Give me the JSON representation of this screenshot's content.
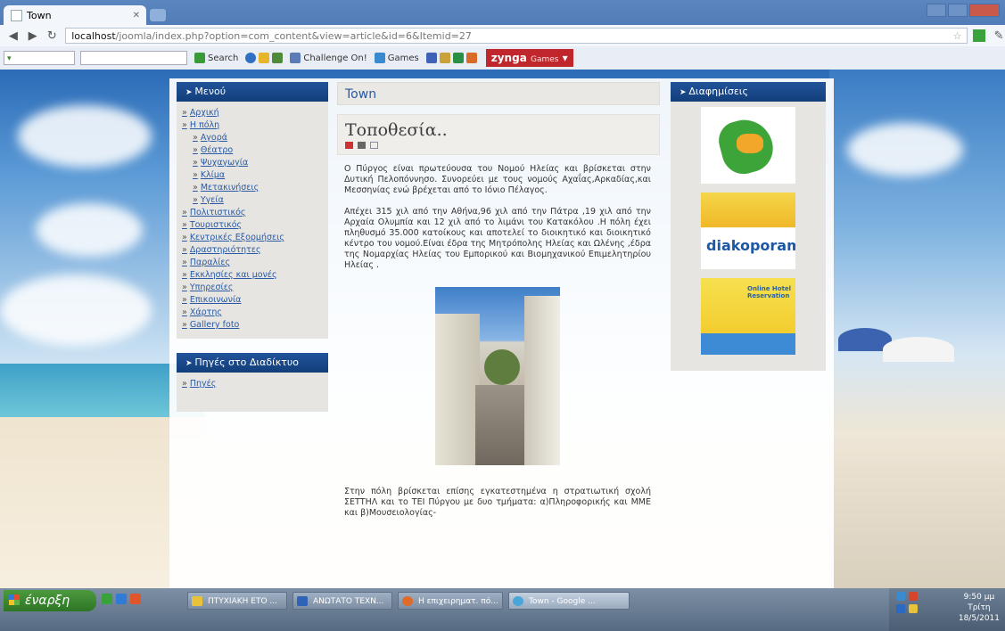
{
  "browser": {
    "tab_title": "Town",
    "url_host": "localhost",
    "url_path": "/joomla/index.php?option=com_content&view=article&id=6&Itemid=27"
  },
  "toolbar": {
    "search_label": "Search",
    "challenge_label": "Challenge On!",
    "games_label": "Games",
    "zynga_label": "zynga",
    "zynga_sub": "Games"
  },
  "left": {
    "menu_heading": "Μενού",
    "menu_items": [
      {
        "label": "Αρχική"
      },
      {
        "label": "Η πόλη"
      },
      {
        "label": "Αγορά"
      },
      {
        "label": "Θέατρο"
      },
      {
        "label": "Ψυχαγωγία"
      },
      {
        "label": "Κλίμα"
      },
      {
        "label": "Μετακινήσεις"
      },
      {
        "label": "Υγεία"
      },
      {
        "label": "Πολιτιστικός"
      },
      {
        "label": "Τουριστικός"
      },
      {
        "label": "Κεντρικές Εξορμήσεις"
      },
      {
        "label": "Δραστηριότητες"
      },
      {
        "label": "Παραλίες"
      },
      {
        "label": "Εκκλησίες και μονές"
      },
      {
        "label": "Υπηρεσίες"
      },
      {
        "label": "Επικοινωνία"
      },
      {
        "label": "Χάρτης"
      },
      {
        "label": "Gallery foto"
      }
    ],
    "links_heading": "Πηγές στο Διαδίκτυο",
    "links_items": [
      {
        "label": "Πηγές"
      }
    ]
  },
  "center": {
    "page_title": "Town",
    "article_title": "Τοποθεσία..",
    "para1": "Ο Πύργος είναι πρωτεύουσα του Νομού Ηλείας και βρίσκεται στην Δυτική Πελοπόννησο. Συνορεύει με τους νομούς Αχαΐας,Αρκαδίας,και Μεσσηνίας ενώ βρέχεται από το Ιόνιο Πέλαγος.",
    "para2": "Απέχει 315 χιλ από την Αθήνα,96 χιλ από την Πάτρα ,19 χιλ από την Αρχαία Ολυμπία και 12 χιλ από το λιμάνι του Κατακόλου .Η πόλη έχει πληθυσμό 35.000 κατοίκους και αποτελεί το διοικητικό και διοικητικό κέντρο του νομού.Είναι έδρα της Μητρόπολης Ηλείας και Ωλένης ,έδρα της Νομαρχίας Ηλείας του Εμπορικού και Βιομηχανικού Επιμελητηρίου Ηλείας .",
    "para3": "Στην πόλη βρίσκεται επίσης εγκατεστημένα η στρατιωτική σχολή ΣΕΤΤΗΛ και το ΤΕΙ Πύργου με δυο τμήματα: α)Πληροφορικής και ΜΜΕ και β)Μουσειολογίας-"
  },
  "right": {
    "ads_heading": "Διαφημίσεις",
    "ad2_text": "diakoporama",
    "ad3_text": "Online Hotel Reservation"
  },
  "taskbar": {
    "start_label": "έναρξη",
    "buttons": [
      {
        "label": "ΠΤΥΧΙΑΚΗ ΕΤΟ ..."
      },
      {
        "label": "ΑΝΩΤΑΤΟ ΤΕΧΝ..."
      },
      {
        "label": "Η επιχειρηματ. πό..."
      },
      {
        "label": "Town - Google ..."
      }
    ],
    "clock_time": "9:50 μμ",
    "clock_day": "Τρίτη",
    "clock_date": "18/5/2011"
  }
}
